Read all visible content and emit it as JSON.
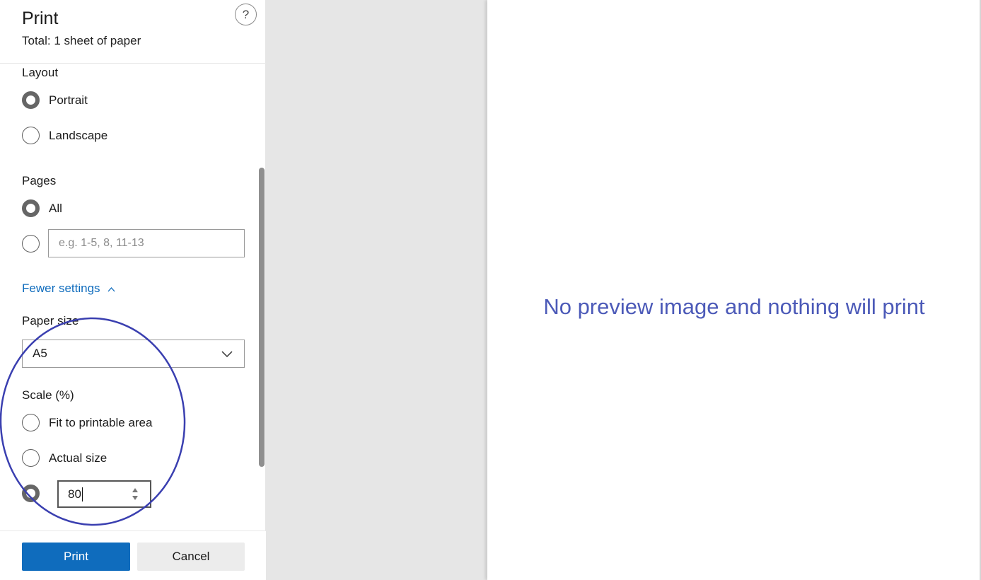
{
  "dialog": {
    "title": "Print",
    "subtitle": "Total: 1 sheet of paper",
    "help_label": "?"
  },
  "layout": {
    "label": "Layout",
    "options": [
      "Portrait",
      "Landscape"
    ],
    "selected": "Portrait"
  },
  "pages": {
    "label": "Pages",
    "all_label": "All",
    "range_placeholder": "e.g. 1-5, 8, 11-13",
    "selected": "All"
  },
  "fewer_settings": "Fewer settings",
  "paper_size": {
    "label": "Paper size",
    "value": "A5"
  },
  "scale": {
    "label": "Scale (%)",
    "fit_label": "Fit to printable area",
    "actual_label": "Actual size",
    "custom_value": "80",
    "selected": "custom"
  },
  "buttons": {
    "print": "Print",
    "cancel": "Cancel"
  },
  "preview": {
    "message": "No preview image and nothing will print"
  },
  "colors": {
    "accent": "#0f6cbd",
    "annotation": "#3a3fb0",
    "preview_text": "#4c5ab8"
  }
}
